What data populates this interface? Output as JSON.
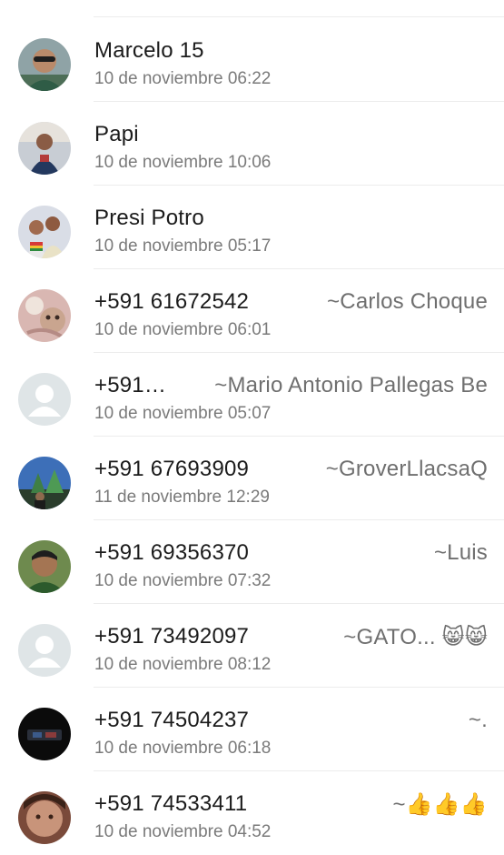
{
  "contacts": [
    {
      "name": "Marcelo 15",
      "pushname": "",
      "time": "10 de noviembre 06:22",
      "avatar": "photo-avatar"
    },
    {
      "name": "Papi",
      "pushname": "",
      "time": "10 de noviembre 10:06",
      "avatar": "photo-avatar"
    },
    {
      "name": "Presi Potro",
      "pushname": "",
      "time": "10 de noviembre 05:17",
      "avatar": "photo-avatar"
    },
    {
      "name": "+591 61672542",
      "pushname": "~Carlos Choque",
      "time": "10 de noviembre 06:01",
      "avatar": "photo-avatar"
    },
    {
      "name": "+591…",
      "pushname": "~Mario Antonio Pallegas Be",
      "time": "10 de noviembre 05:07",
      "avatar": "default-person-avatar"
    },
    {
      "name": "+591 67693909",
      "pushname": "~GroverLlacsaQ",
      "time": "11 de noviembre 12:29",
      "avatar": "photo-avatar"
    },
    {
      "name": "+591 69356370",
      "pushname": "~Luis",
      "time": "10 de noviembre 07:32",
      "avatar": "photo-avatar"
    },
    {
      "name": "+591 73492097",
      "pushname": "~GATO... 😸😸",
      "time": "10 de noviembre 08:12",
      "avatar": "default-person-avatar"
    },
    {
      "name": "+591 74504237",
      "pushname": "~.",
      "time": "10 de noviembre 06:18",
      "avatar": "photo-avatar"
    },
    {
      "name": "+591 74533411",
      "pushname": "~👍👍👍",
      "time": "10 de noviembre 04:52",
      "avatar": "photo-avatar"
    }
  ]
}
